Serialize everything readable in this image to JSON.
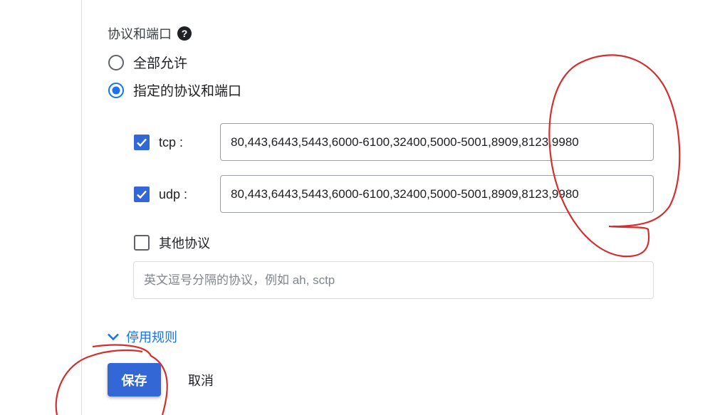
{
  "section": {
    "title": "协议和端口"
  },
  "radios": [
    {
      "label": "全部允许",
      "selected": false
    },
    {
      "label": "指定的协议和端口",
      "selected": true
    }
  ],
  "protocols": {
    "tcp": {
      "label": "tcp :",
      "checked": true,
      "value": "80,443,6443,5443,6000-6100,32400,5000-5001,8909,8123,9980"
    },
    "udp": {
      "label": "udp :",
      "checked": true,
      "value": "80,443,6443,5443,6000-6100,32400,5000-5001,8909,8123,9980"
    },
    "other": {
      "label": "其他协议",
      "checked": false,
      "placeholder": "英文逗号分隔的协议，例如 ah, sctp"
    }
  },
  "disable_rule": {
    "label": "停用规则"
  },
  "actions": {
    "save": "保存",
    "cancel": "取消"
  },
  "colors": {
    "accent": "#1a73e8",
    "button": "#3367d6",
    "annotation": "#d32f2f"
  },
  "icons": {
    "help": "help-circle-icon",
    "expand": "chevron-down-icon"
  }
}
